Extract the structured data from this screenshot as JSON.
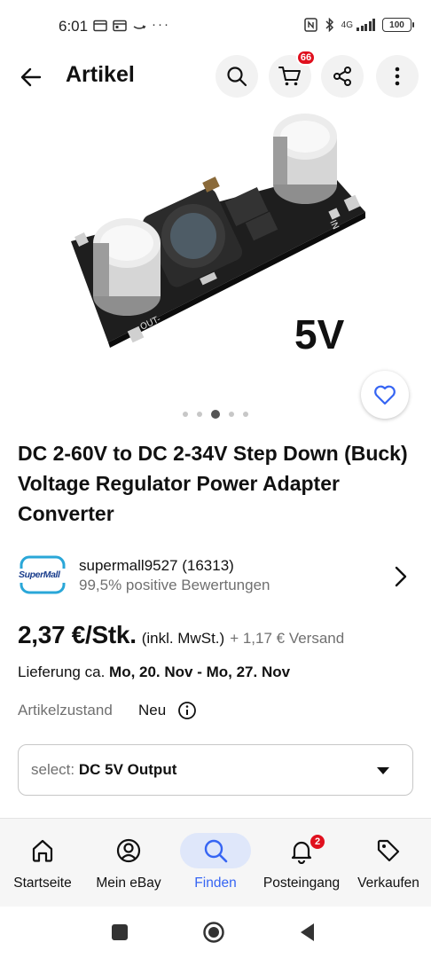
{
  "status_bar": {
    "time": "6:01",
    "network": "4G",
    "battery": "100"
  },
  "header": {
    "title": "Artikel",
    "cart_badge": "66"
  },
  "product": {
    "image_overlay_text": "5V",
    "image_count": 5,
    "active_image_index": 2,
    "title": "DC 2-60V to DC 2-34V Step Down (Buck) Voltage Regulator Power Adapter Converter",
    "seller_logo_text": "SuperMall",
    "seller_name": "supermall9527 (16313)",
    "seller_rating": "99,5% positive Bewertungen",
    "price": "2,37 €/Stk.",
    "vat_note": "(inkl. MwSt.)",
    "shipping": "+ 1,17 € Versand",
    "delivery_prefix": "Lieferung ca.",
    "delivery_dates": "Mo, 20. Nov - Mo, 27. Nov",
    "condition_label": "Artikelzustand",
    "condition_value": "Neu",
    "variation_label": "select:",
    "variation_value": "DC 5V Output"
  },
  "bottom_nav": {
    "items": [
      {
        "label": "Startseite",
        "icon": "home-icon"
      },
      {
        "label": "Mein eBay",
        "icon": "user-icon"
      },
      {
        "label": "Finden",
        "icon": "search-icon"
      },
      {
        "label": "Posteingang",
        "icon": "bell-icon",
        "badge": "2"
      },
      {
        "label": "Verkaufen",
        "icon": "tag-icon"
      }
    ],
    "active_index": 2
  },
  "colors": {
    "accent": "#3665f3",
    "badge": "#e0101e",
    "muted_text": "#707070"
  }
}
